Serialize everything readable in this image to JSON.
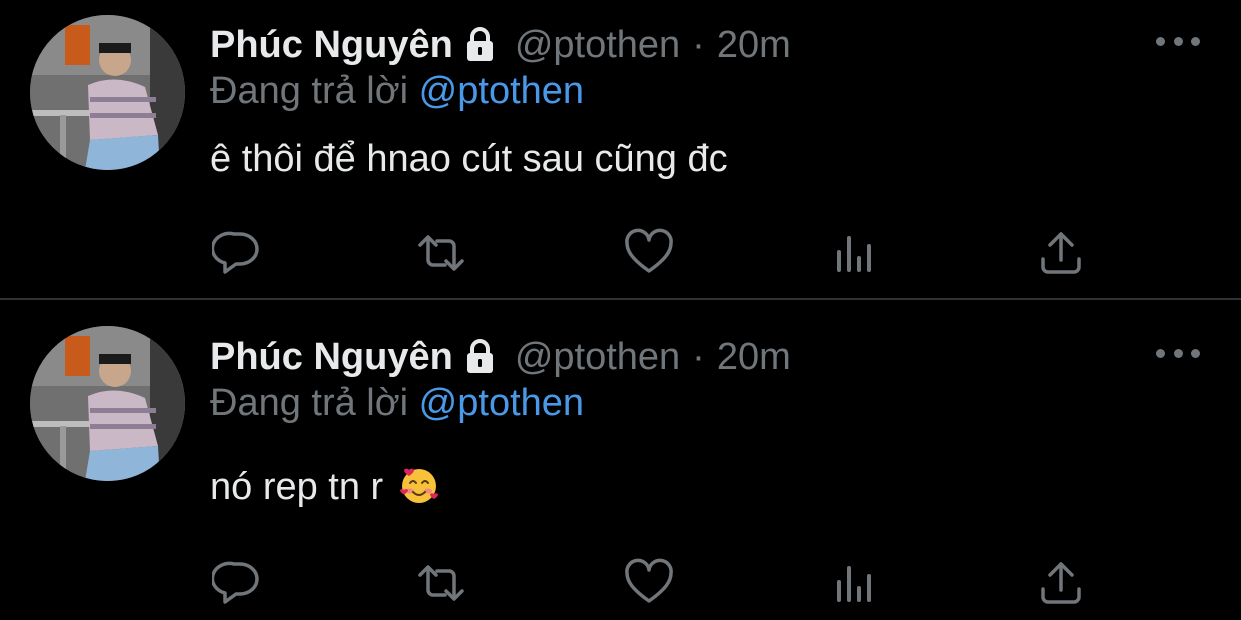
{
  "colors": {
    "background": "#000000",
    "primary_text": "#e7e9ea",
    "secondary_text": "#71767b",
    "mention": "#4a99e9",
    "divider": "#2f3336"
  },
  "tweets": [
    {
      "author_name": "Phúc Nguyên",
      "author_handle": "@ptothen",
      "separator": "·",
      "time": "20m",
      "replying_label": "Đang trả lời",
      "replying_to": "@ptothen",
      "text": "ê thôi để hnao cút sau cũng đc",
      "icons": [
        "lock-icon",
        "more-icon",
        "reply-icon",
        "retweet-icon",
        "like-icon",
        "analytics-icon",
        "share-icon"
      ]
    },
    {
      "author_name": "Phúc Nguyên",
      "author_handle": "@ptothen",
      "separator": "·",
      "time": "20m",
      "replying_label": "Đang trả lời",
      "replying_to": "@ptothen",
      "text": "nó rep tn r",
      "emoji": "smiling-face-with-hearts-emoji",
      "icons": [
        "lock-icon",
        "more-icon",
        "reply-icon",
        "retweet-icon",
        "like-icon",
        "analytics-icon",
        "share-icon"
      ]
    }
  ]
}
